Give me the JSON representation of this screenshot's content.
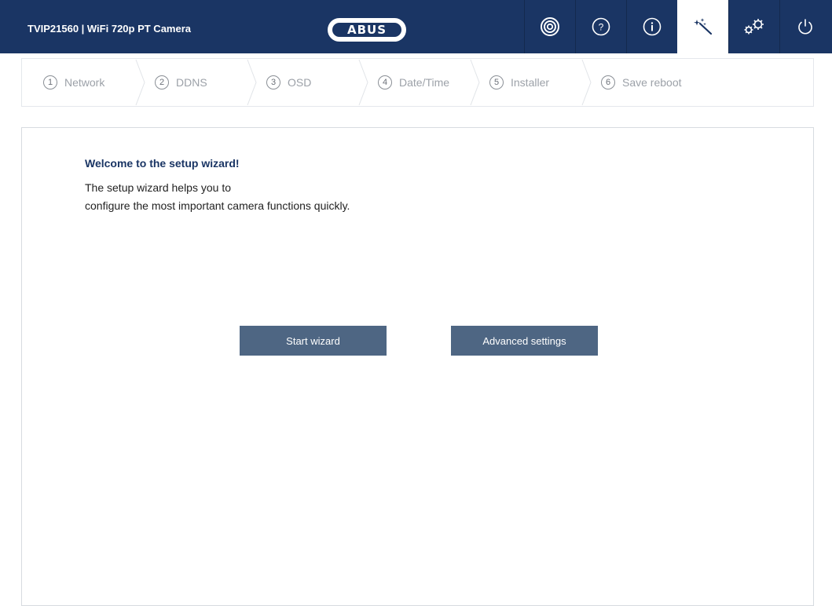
{
  "header": {
    "title": "TVIP21560  |  WiFi 720p PT Camera",
    "logo_text": "ABUS",
    "nav": [
      {
        "name": "live-view",
        "icon": "camera-lens-icon"
      },
      {
        "name": "help",
        "icon": "question-icon"
      },
      {
        "name": "info",
        "icon": "info-icon"
      },
      {
        "name": "wizard",
        "icon": "magic-wand-icon",
        "active": true
      },
      {
        "name": "settings",
        "icon": "gears-icon"
      },
      {
        "name": "logout",
        "icon": "power-icon"
      }
    ]
  },
  "wizard_steps": [
    {
      "number": "1",
      "label": "Network"
    },
    {
      "number": "2",
      "label": "DDNS"
    },
    {
      "number": "3",
      "label": "OSD"
    },
    {
      "number": "4",
      "label": "Date/Time"
    },
    {
      "number": "5",
      "label": "Installer"
    },
    {
      "number": "6",
      "label": "Save reboot"
    }
  ],
  "welcome": {
    "title": "Welcome to the setup wizard!",
    "line1": "The setup wizard helps you to",
    "line2": "configure the most important camera functions quickly."
  },
  "buttons": {
    "start": "Start wizard",
    "advanced": "Advanced settings"
  },
  "colors": {
    "header_bg": "#1a3564",
    "button_bg": "#4e6683",
    "title_color": "#1a3564"
  }
}
